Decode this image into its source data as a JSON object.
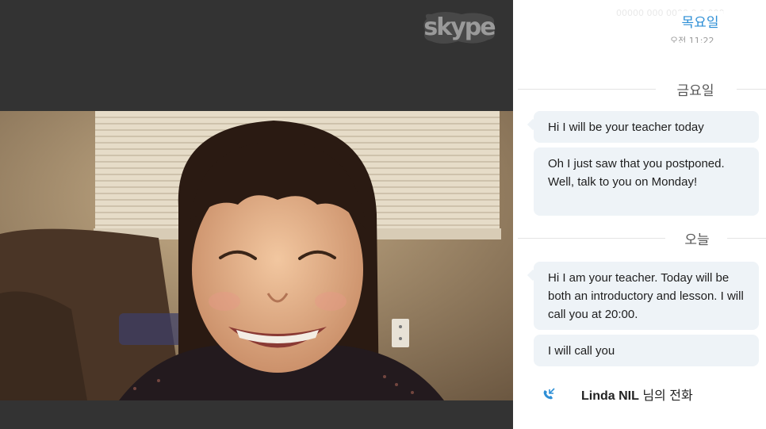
{
  "app": {
    "logo_text": "skype"
  },
  "chat": {
    "faded_header": "00000 000 0000 0 0 000",
    "thursday_label": "목요일",
    "thursday_time": "오전 11:22",
    "friday_label": "금요일",
    "today_label": "오늘",
    "messages": [
      {
        "text": "Hi I will be your teacher today"
      },
      {
        "text": "Oh I just saw that you postponed. Well, talk to you on Monday!"
      },
      {
        "text": "Hi I am your teacher. Today will be both an introductory and lesson. I will call you at 20:00."
      },
      {
        "text": "I will call you"
      }
    ],
    "call": {
      "caller": "Linda NIL",
      "suffix": " 님의 전화"
    }
  },
  "colors": {
    "accent": "#2e8fd6",
    "bubble": "#eef3f7",
    "video_frame": "#333333"
  }
}
